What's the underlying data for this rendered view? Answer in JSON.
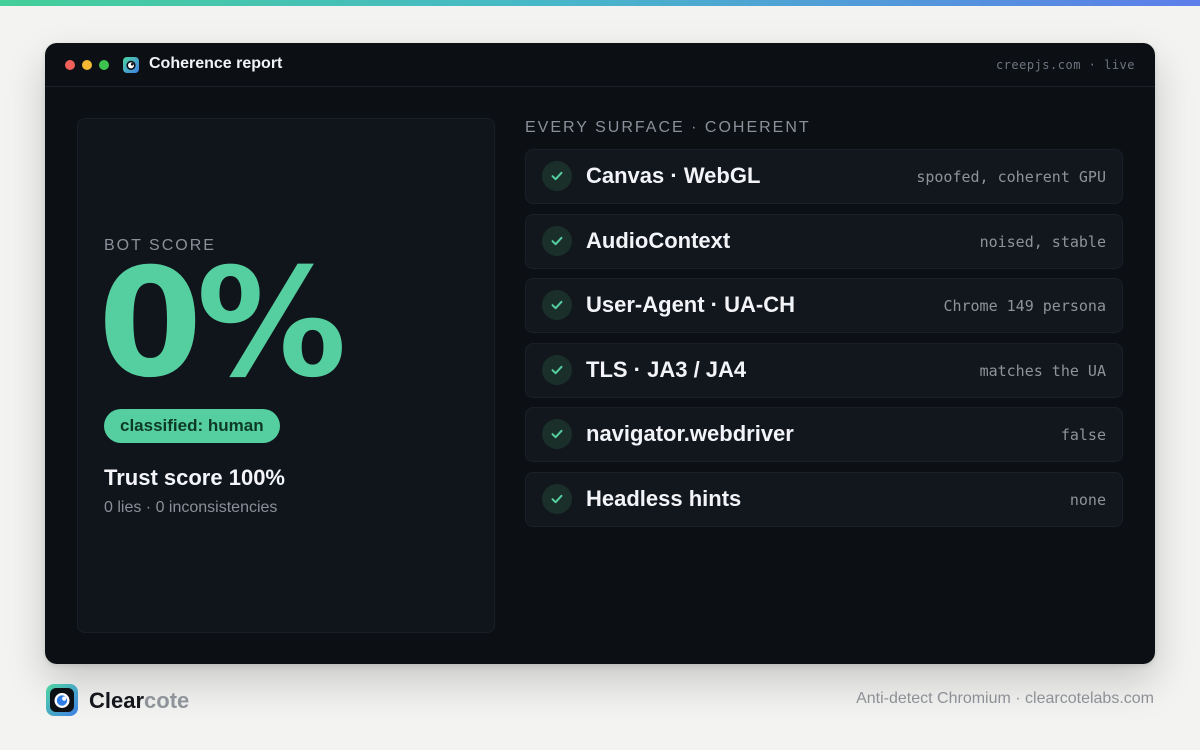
{
  "window": {
    "title": "Coherence report",
    "source": "creepjs.com · live"
  },
  "score_panel": {
    "label": "BOT SCORE",
    "value": "0%",
    "classification": "classified: human",
    "trust": "Trust score 100%",
    "subline": "0 lies · 0 inconsistencies"
  },
  "surfaces": {
    "heading": "EVERY SURFACE · COHERENT",
    "items": [
      {
        "name": "Canvas · WebGL",
        "status": "spoofed, coherent GPU"
      },
      {
        "name": "AudioContext",
        "status": "noised, stable"
      },
      {
        "name": "User-Agent · UA-CH",
        "status": "Chrome 149 persona"
      },
      {
        "name": "TLS · JA3 / JA4",
        "status": "matches the UA"
      },
      {
        "name": "navigator.webdriver",
        "status": "false"
      },
      {
        "name": "Headless hints",
        "status": "none"
      }
    ]
  },
  "footer": {
    "brand_part1": "Clear",
    "brand_part2": "cote",
    "tagline": "Anti-detect Chromium · clearcotelabs.com"
  },
  "icons": {
    "window": "clearcote-logo-icon",
    "check": "check-icon",
    "brand": "clearcote-logo-icon"
  },
  "colors": {
    "accent": "#55cf9f",
    "window_bg": "#0c0f14",
    "page_bg": "#f3f3f1"
  }
}
